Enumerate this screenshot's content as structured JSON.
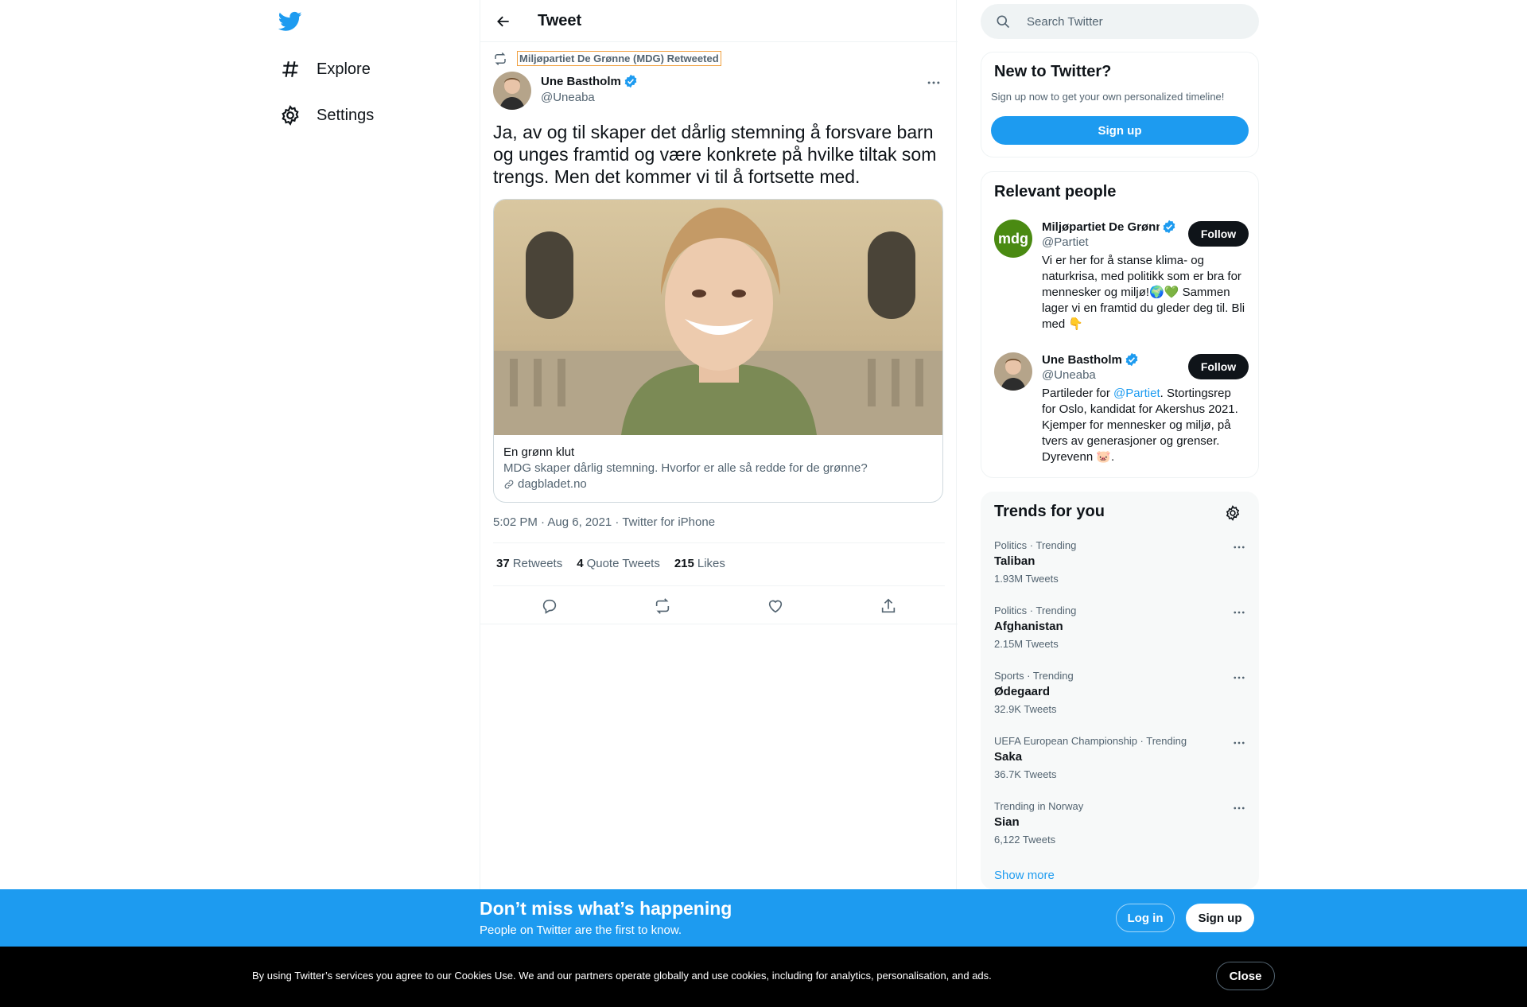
{
  "nav": {
    "logo": "twitter-bird-icon",
    "items": [
      {
        "label": "Explore",
        "icon": "hashtag-icon"
      },
      {
        "label": "Settings",
        "icon": "gear-icon"
      }
    ]
  },
  "header": {
    "title": "Tweet"
  },
  "tweet": {
    "retweeted_by": "Miljøpartiet De Grønne (MDG) Retweeted",
    "author_name": "Une Bastholm",
    "author_handle": "@Uneaba",
    "text": "Ja, av og til skaper det dårlig stemning å forsvare barn og unges framtid og være konkrete på hvilke tiltak som trengs. Men det kommer vi til å fortsette med.",
    "card": {
      "title": "En grønn klut",
      "description": "MDG skaper dårlig stemning. Hvorfor er alle så redde for de grønne?",
      "domain": "dagbladet.no"
    },
    "meta": "5:02 PM · Aug 6, 2021 · Twitter for iPhone",
    "stats": {
      "retweets_count": "37",
      "retweets_label": "Retweets",
      "quotes_count": "4",
      "quotes_label": "Quote Tweets",
      "likes_count": "215",
      "likes_label": "Likes"
    }
  },
  "search": {
    "placeholder": "Search Twitter"
  },
  "new_to_twitter": {
    "title": "New to Twitter?",
    "subtitle": "Sign up now to get your own personalized timeline!",
    "button": "Sign up"
  },
  "relevant_people": {
    "title": "Relevant people",
    "people": [
      {
        "name": "Miljøpartiet De Grønne",
        "handle": "@Partiet",
        "avatar_text": "mdg",
        "follow": "Follow",
        "bio": "Vi er her for å stanse klima- og naturkrisa, med politikk som er bra for mennesker og miljø!🌍💚 Sammen lager vi en framtid du gleder deg til. Bli med 👇"
      },
      {
        "name": "Une Bastholm",
        "handle": "@Uneaba",
        "follow": "Follow",
        "bio_pre": "Partileder for ",
        "bio_link": "@Partiet",
        "bio_post": ". Stortingsrep for Oslo, kandidat for Akershus 2021. Kjemper for mennesker og miljø, på tvers av generasjoner og grenser. Dyrevenn 🐷."
      }
    ]
  },
  "trends": {
    "title": "Trends for you",
    "items": [
      {
        "meta": "Politics · Trending",
        "name": "Taliban",
        "count": "1.93M Tweets"
      },
      {
        "meta": "Politics · Trending",
        "name": "Afghanistan",
        "count": "2.15M Tweets"
      },
      {
        "meta": "Sports · Trending",
        "name": "Ødegaard",
        "count": "32.9K Tweets"
      },
      {
        "meta": "UEFA European Championship · Trending",
        "name": "Saka",
        "count": "36.7K Tweets"
      },
      {
        "meta": "Trending in Norway",
        "name": "Sian",
        "count": "6,122 Tweets"
      }
    ],
    "show_more": "Show more"
  },
  "banner": {
    "title": "Don’t miss what’s happening",
    "subtitle": "People on Twitter are the first to know.",
    "login": "Log in",
    "signup": "Sign up"
  },
  "cookie": {
    "text": "By using Twitter’s services you agree to our Cookies Use. We and our partners operate globally and use cookies, including for analytics, personalisation, and ads.",
    "close": "Close"
  },
  "colors": {
    "accent": "#1d9bf0",
    "text": "#0f1419",
    "secondary": "#536471",
    "mdg_green": "#4a8a12"
  }
}
